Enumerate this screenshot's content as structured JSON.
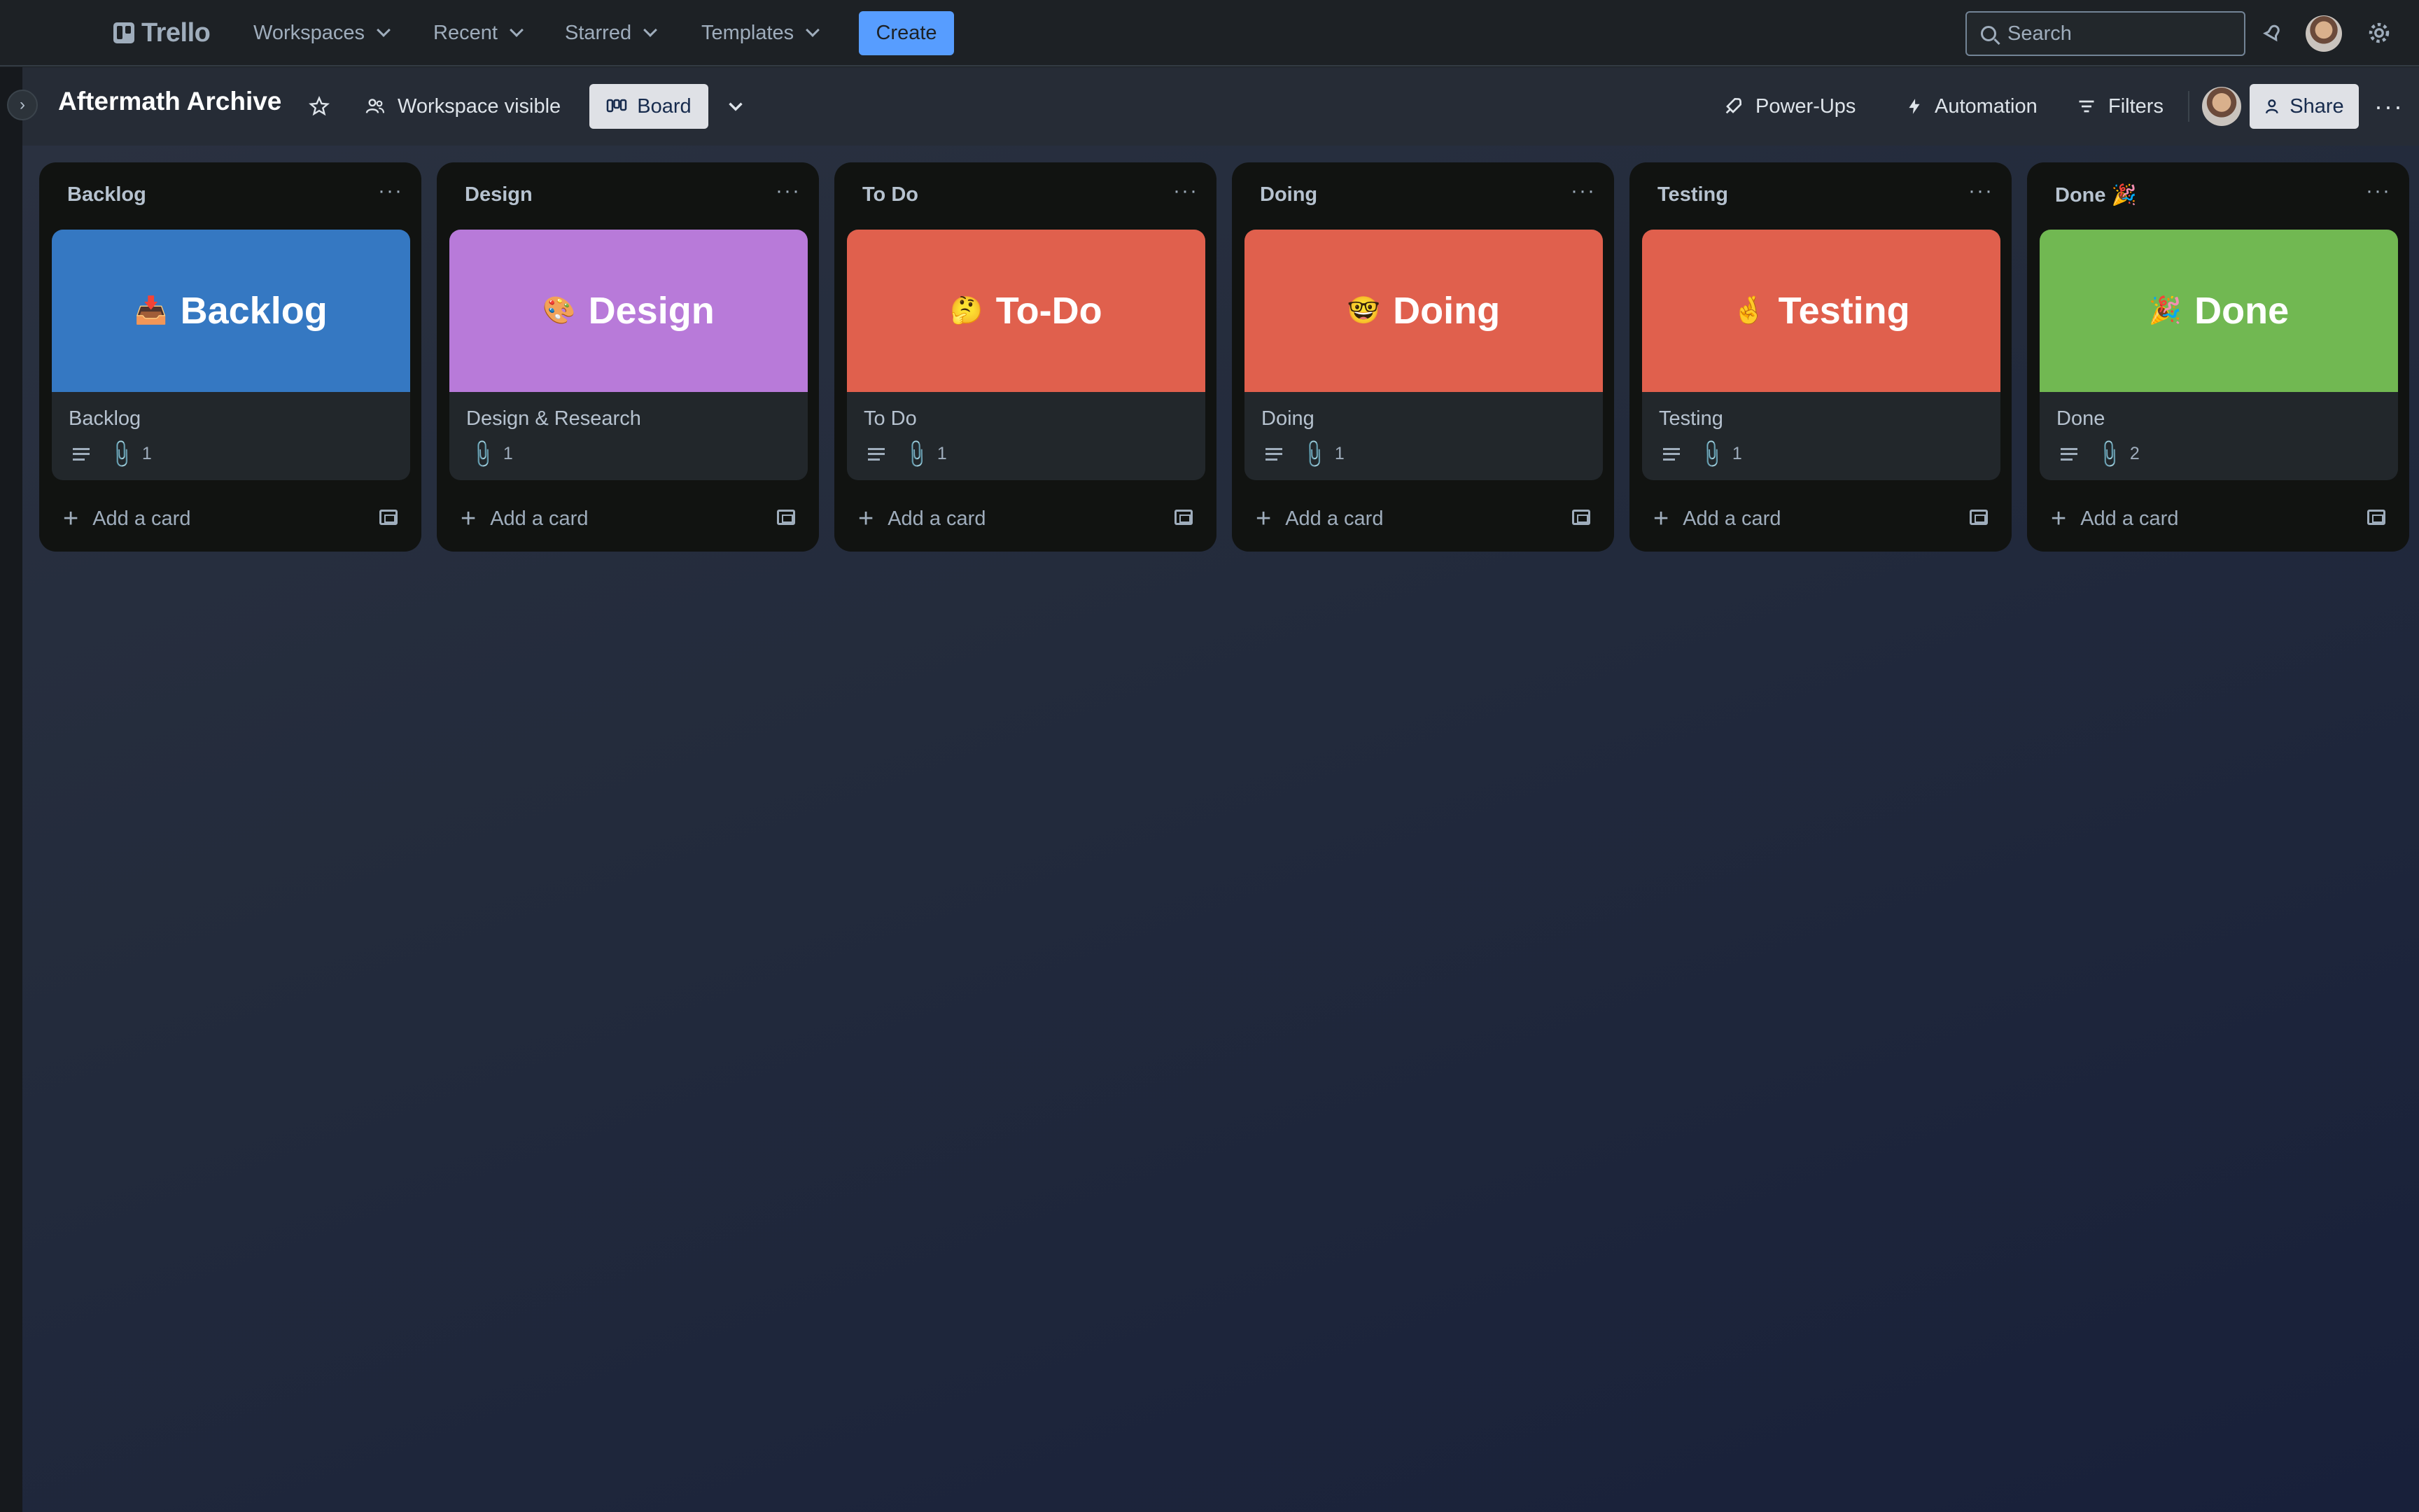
{
  "nav": {
    "logo": "Trello",
    "menus": [
      "Workspaces",
      "Recent",
      "Starred",
      "Templates"
    ],
    "create_label": "Create",
    "search_placeholder": "Search"
  },
  "board": {
    "title": "Aftermath Archive",
    "visibility_label": "Workspace visible",
    "view_label": "Board",
    "powerups_label": "Power-Ups",
    "automation_label": "Automation",
    "filters_label": "Filters",
    "share_label": "Share"
  },
  "lists": [
    {
      "name": "Backlog",
      "cover_emoji": "📥",
      "cover_text": "Backlog",
      "cover_color": "#3578c2",
      "card_title": "Backlog",
      "has_description": true,
      "attachments": "1"
    },
    {
      "name": "Design",
      "cover_emoji": "🎨",
      "cover_text": "Design",
      "cover_color": "#b87ad9",
      "card_title": "Design & Research",
      "has_description": false,
      "attachments": "1"
    },
    {
      "name": "To Do",
      "cover_emoji": "🤔",
      "cover_text": "To-Do",
      "cover_color": "#e0604d",
      "card_title": "To Do",
      "has_description": true,
      "attachments": "1"
    },
    {
      "name": "Doing",
      "cover_emoji": "🤓",
      "cover_text": "Doing",
      "cover_color": "#e0604d",
      "card_title": "Doing",
      "has_description": true,
      "attachments": "1"
    },
    {
      "name": "Testing",
      "cover_emoji": "🤞",
      "cover_text": "Testing",
      "cover_color": "#e0604d",
      "card_title": "Testing",
      "has_description": true,
      "attachments": "1"
    },
    {
      "name": "Done 🎉",
      "cover_emoji": "🎉",
      "cover_text": "Done",
      "cover_color": "#71b852",
      "card_title": "Done",
      "has_description": true,
      "attachments": "2"
    }
  ],
  "add_card_label": "Add a card"
}
